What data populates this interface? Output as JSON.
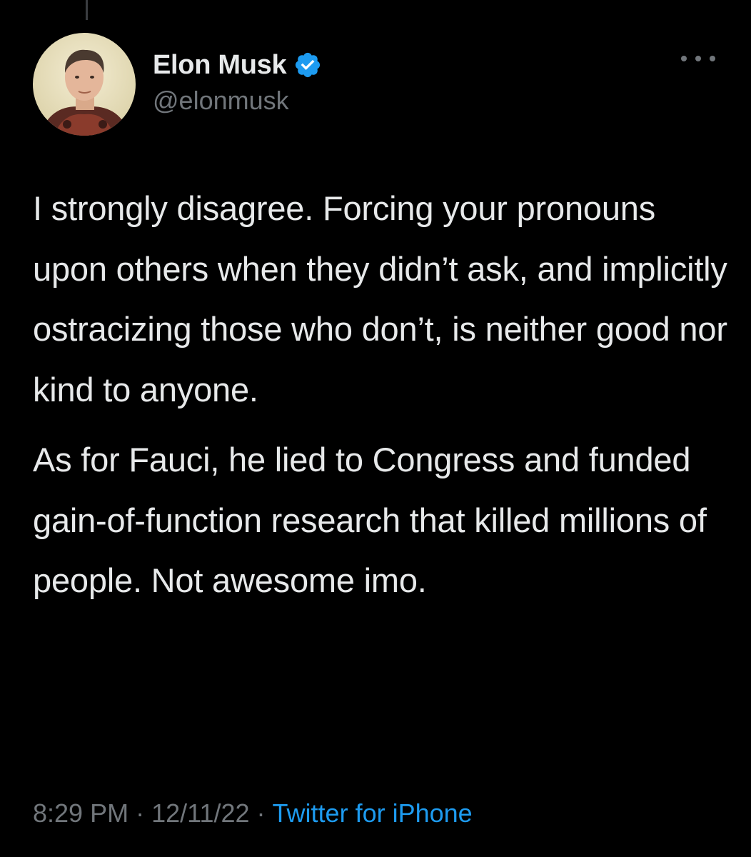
{
  "tweet": {
    "author": {
      "display_name": "Elon Musk",
      "handle": "@elonmusk",
      "verified": true,
      "avatar_icon": "user-avatar"
    },
    "paragraphs": [
      "I strongly disagree. Forcing your pronouns upon others when they didn’t ask, and implicitly ostracizing those who don’t, is neither good nor kind to anyone.",
      "As for Fauci, he lied to Congress and funded gain-of-function research that killed millions of people. Not awesome imo."
    ],
    "time": "8:29 PM",
    "date": "12/11/22",
    "separator": "·",
    "source": "Twitter for iPhone"
  },
  "colors": {
    "background": "#000000",
    "text_primary": "#e7e9ea",
    "text_secondary": "#71767b",
    "accent": "#1d9bf0"
  },
  "icons": {
    "verified": "verified-badge-icon",
    "more": "more-options-icon"
  }
}
